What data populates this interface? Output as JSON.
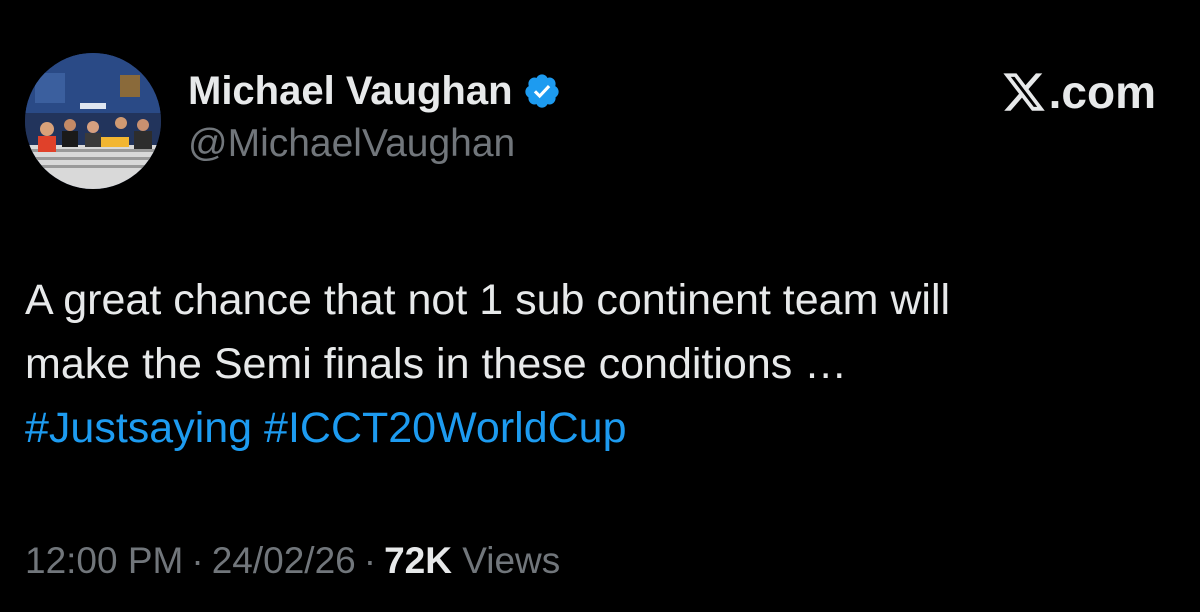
{
  "author": {
    "name": "Michael Vaughan",
    "handle": "@MichaelVaughan",
    "verified": true,
    "verified_color": "#1d9bf0",
    "avatar_icon": "profile-photo"
  },
  "brand": {
    "icon": "x-logo-icon",
    "text": ".com"
  },
  "tweet": {
    "line1": "A great chance that not 1 sub continent team will",
    "line2": "make the Semi finals in these conditions …",
    "hashtags": [
      "#Justsaying",
      "#ICCT20WorldCup"
    ],
    "hashtag_color": "#1d9bf0"
  },
  "meta": {
    "time": "12:00 PM",
    "separator": "·",
    "date": "24/02/26",
    "views_count": "72K",
    "views_label": "Views"
  },
  "colors": {
    "background": "#000000",
    "text_primary": "#e7e9ea",
    "text_secondary": "#71767b"
  }
}
